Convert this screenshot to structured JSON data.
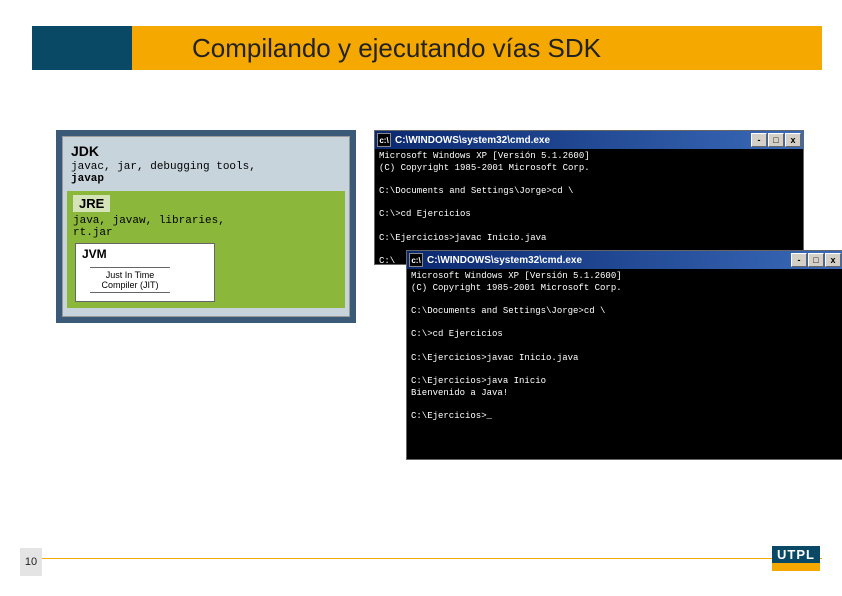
{
  "header": {
    "title": "Compilando y ejecutando vías SDK"
  },
  "jdk": {
    "title": "JDK",
    "items_prefix": "javac, jar, debugging tools,",
    "items_bold": "javap",
    "jre": {
      "title": "JRE",
      "items": "java, javaw, libraries,\nrt.jar"
    },
    "jvm": {
      "title": "JVM",
      "jit": "Just In Time\nCompiler (JIT)"
    }
  },
  "cmd1": {
    "title": "C:\\WINDOWS\\system32\\cmd.exe",
    "body": "Microsoft Windows XP [Versión 5.1.2600]\n(C) Copyright 1985-2001 Microsoft Corp.\n\nC:\\Documents and Settings\\Jorge>cd \\\n\nC:\\>cd Ejercicios\n\nC:\\Ejercicios>javac Inicio.java\n\nC:\\"
  },
  "cmd2": {
    "title": "C:\\WINDOWS\\system32\\cmd.exe",
    "body": "Microsoft Windows XP [Versión 5.1.2600]\n(C) Copyright 1985-2001 Microsoft Corp.\n\nC:\\Documents and Settings\\Jorge>cd \\\n\nC:\\>cd Ejercicios\n\nC:\\Ejercicios>javac Inicio.java\n\nC:\\Ejercicios>java Inicio\nBienvenido a Java!\n\nC:\\Ejercicios>_"
  },
  "cmd_buttons": {
    "min": "-",
    "max": "□",
    "close": "x"
  },
  "footer": {
    "page": "10",
    "logo_text": "UTPL"
  }
}
